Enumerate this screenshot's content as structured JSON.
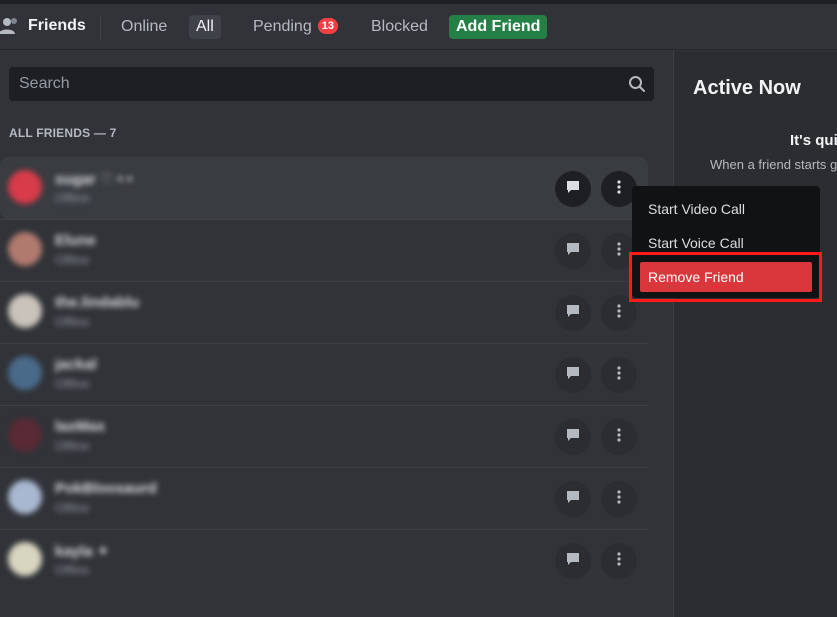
{
  "header": {
    "title": "Friends",
    "tabs": [
      {
        "label": "Online"
      },
      {
        "label": "All"
      },
      {
        "label": "Pending",
        "badge": "13"
      },
      {
        "label": "Blocked"
      },
      {
        "label": "Add Friend"
      }
    ]
  },
  "search": {
    "placeholder": "Search"
  },
  "friends_section": {
    "label": "ALL FRIENDS — 7",
    "friends": [
      {
        "name": "sugar ♡ • •",
        "status": "Offline"
      },
      {
        "name": "Elune",
        "status": "Offline"
      },
      {
        "name": "the.lindablu",
        "status": "Offline"
      },
      {
        "name": "jackal",
        "status": "Offline"
      },
      {
        "name": "laxMax",
        "status": "Offline"
      },
      {
        "name": "PokBloosaurd",
        "status": "Offline"
      },
      {
        "name": "kayla ✦",
        "status": "Offline"
      }
    ]
  },
  "active_now": {
    "title": "Active Now",
    "empty_title": "It's qui",
    "empty_desc": "When a friend starts game or hanging out o"
  },
  "context_menu": {
    "items": [
      {
        "label": "Start Video Call"
      },
      {
        "label": "Start Voice Call"
      },
      {
        "label": "Remove Friend"
      }
    ]
  },
  "colors": {
    "background": "#313338",
    "accent_green": "#248046",
    "danger_red": "#da373c",
    "highlight_red": "#ff1a1a"
  },
  "icons": {
    "friends": "friends-icon",
    "search": "search-icon",
    "message": "message-icon",
    "more": "more-vertical-icon"
  }
}
